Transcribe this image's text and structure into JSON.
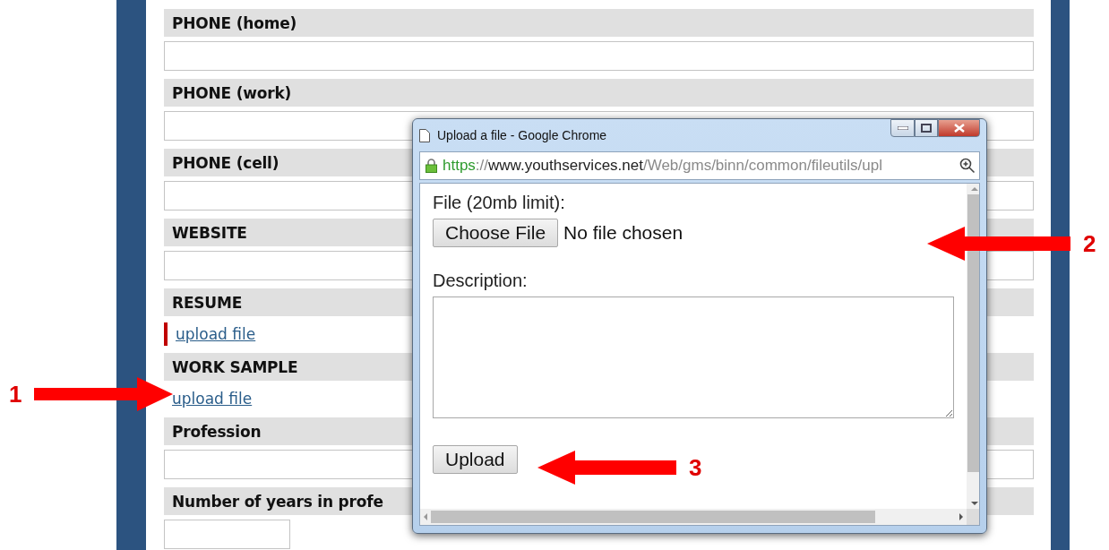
{
  "form": {
    "fields": [
      {
        "label": "PHONE (home)",
        "kind": "input",
        "flagged": false
      },
      {
        "label": "PHONE (work)",
        "kind": "input",
        "flagged": false
      },
      {
        "label": "PHONE (cell)",
        "kind": "input",
        "flagged": false
      },
      {
        "label": "WEBSITE",
        "kind": "input",
        "flagged": false
      },
      {
        "label": "RESUME",
        "kind": "link",
        "link": "upload file",
        "flagged": true
      },
      {
        "label": "WORK SAMPLE",
        "kind": "link",
        "link": "upload file",
        "flagged": false
      },
      {
        "label": "Profession",
        "kind": "input",
        "flagged": false
      },
      {
        "label": "Number of years in profe",
        "kind": "short-input",
        "flagged": false
      }
    ]
  },
  "dialog": {
    "title": "Upload a file - Google Chrome",
    "url": [
      {
        "kind": "scheme",
        "text": "https"
      },
      {
        "kind": "dim",
        "text": "://"
      },
      {
        "kind": "host",
        "text": "www.youthservices.net"
      },
      {
        "kind": "dim",
        "text": "/Web/gms/binn/common/fileutils/upl"
      }
    ],
    "file_label": "File (20mb limit):",
    "choose_button": "Choose File",
    "file_status": "No file chosen",
    "description_label": "Description:",
    "upload_button": "Upload"
  },
  "callouts": [
    {
      "number": "1"
    },
    {
      "number": "2"
    },
    {
      "number": "3"
    }
  ]
}
